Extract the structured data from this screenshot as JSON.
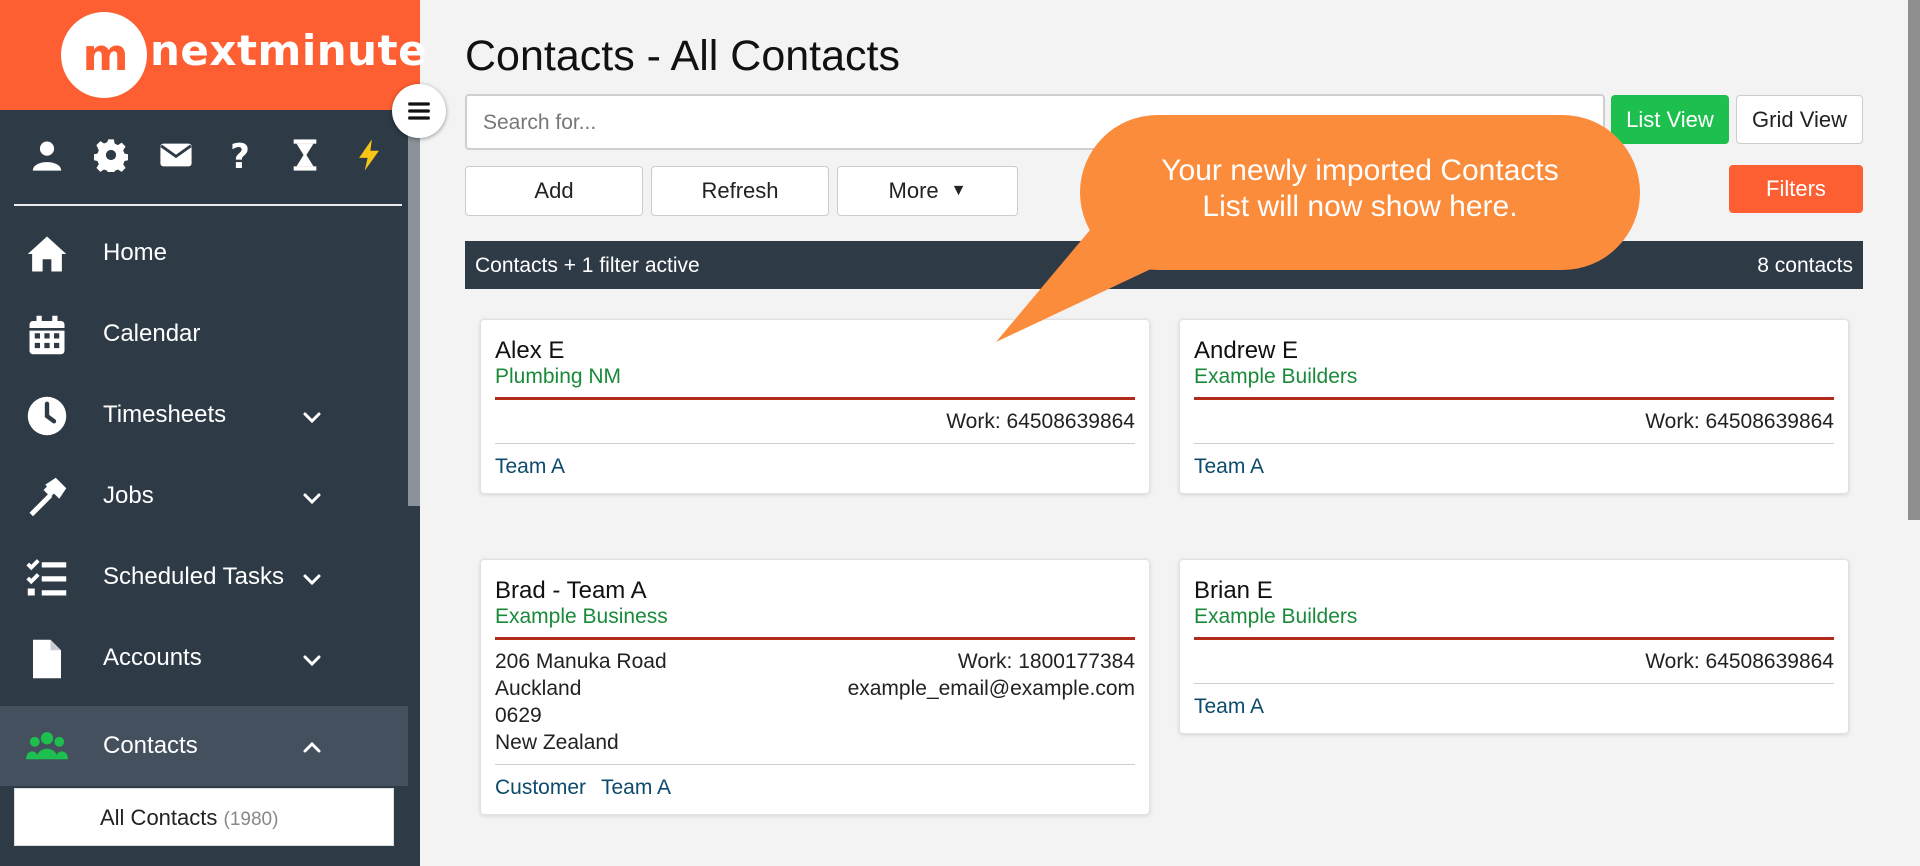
{
  "brand": {
    "logo_mark": "m",
    "name": "nextminute",
    "accent": "#fd5f32"
  },
  "toolbar": {
    "icons": [
      "user-icon",
      "gear-icon",
      "envelope-icon",
      "question-icon",
      "hourglass-icon",
      "lightning-icon"
    ],
    "lightning_color": "#f5c518"
  },
  "sidebar": {
    "items": [
      {
        "label": "Home",
        "icon": "home-icon"
      },
      {
        "label": "Calendar",
        "icon": "calendar-icon"
      },
      {
        "label": "Timesheets",
        "icon": "clock-icon"
      },
      {
        "label": "Jobs",
        "icon": "hammer-icon"
      },
      {
        "label": "Scheduled Tasks",
        "icon": "tasks-icon"
      },
      {
        "label": "Accounts",
        "icon": "document-icon"
      },
      {
        "label": "Contacts",
        "icon": "people-icon"
      }
    ],
    "submenu": {
      "label": "All Contacts",
      "count": "(1980)"
    }
  },
  "page": {
    "title": "Contacts - All Contacts"
  },
  "search": {
    "placeholder": "Search for..."
  },
  "buttons": {
    "list_view": "List View",
    "grid_view": "Grid View",
    "add": "Add",
    "refresh": "Refresh",
    "more": "More",
    "filters": "Filters"
  },
  "filter_bar": {
    "status": "Contacts + 1 filter active",
    "count": "8 contacts"
  },
  "callout": {
    "line1": "Your newly imported Contacts",
    "line2": "List will now show here."
  },
  "contacts": [
    {
      "name": "Alex E",
      "company": "Plumbing NM",
      "work": "Work: 64508639864",
      "tags": [
        "Team A"
      ]
    },
    {
      "name": "Andrew E",
      "company": "Example Builders",
      "work": "Work: 64508639864",
      "tags": [
        "Team A"
      ]
    },
    {
      "name": "Brad - Team A",
      "company": "Example Business",
      "work": "Work: 1800177384",
      "email": "example_email@example.com",
      "address": [
        "206 Manuka Road",
        "Auckland",
        "0629",
        "New Zealand"
      ],
      "tags": [
        "Customer",
        "Team A"
      ]
    },
    {
      "name": "Brian E",
      "company": "Example Builders",
      "work": "Work: 64508639864",
      "tags": [
        "Team A"
      ]
    }
  ]
}
